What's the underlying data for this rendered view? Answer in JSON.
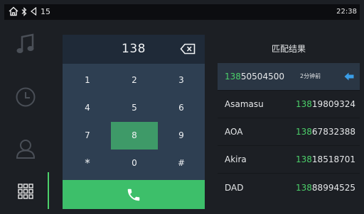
{
  "status_bar": {
    "notification_count": "15",
    "time": "22:38",
    "icons": [
      "home-icon",
      "bluetooth-icon",
      "volume-icon"
    ]
  },
  "side_nav": {
    "items": [
      {
        "name": "music",
        "icon": "music-note-icon"
      },
      {
        "name": "call-history",
        "icon": "clock-icon"
      },
      {
        "name": "contacts",
        "icon": "person-icon"
      },
      {
        "name": "dialpad",
        "icon": "dialpad-grid-icon",
        "active": true
      }
    ]
  },
  "dialer": {
    "number": "138",
    "backspace_icon": "backspace-icon",
    "keys": [
      "1",
      "2",
      "3",
      "4",
      "5",
      "6",
      "7",
      "8",
      "9",
      "*",
      "0",
      "#"
    ],
    "pressed_key": "8",
    "call_icon": "phone-icon"
  },
  "matches": {
    "title": "匹配结果",
    "rows": [
      {
        "name": "",
        "number_match": "138",
        "number_rest": "50504500",
        "time": "2分钟前",
        "icon": "arrow-left-icon"
      },
      {
        "name": "Asamasu",
        "number_match": "138",
        "number_rest": "19809324"
      },
      {
        "name": "AOA",
        "number_match": "138",
        "number_rest": "67832388"
      },
      {
        "name": "Akira",
        "number_match": "138",
        "number_rest": "18518701"
      },
      {
        "name": "DAD",
        "number_match": "138",
        "number_rest": "88994525"
      }
    ]
  },
  "colors": {
    "accent_green": "#4cd06a",
    "call_green": "#3dbf6a",
    "pressed_key": "#3e9a68",
    "keypad_bg": "#2e3f52",
    "arrow_blue": "#3a9ee8"
  }
}
